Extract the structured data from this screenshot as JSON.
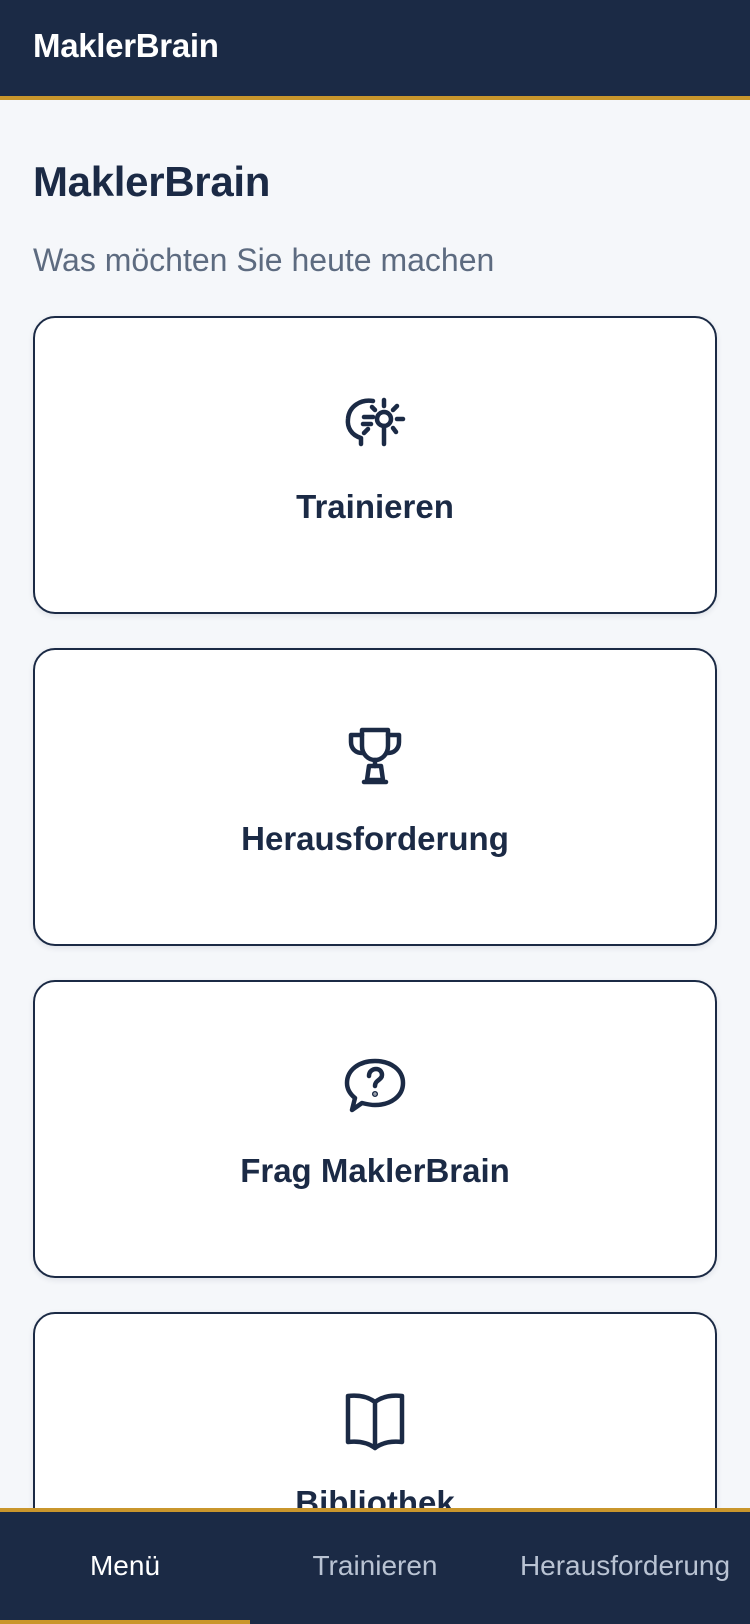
{
  "app": {
    "title": "MaklerBrain"
  },
  "main": {
    "title": "MaklerBrain",
    "subtitle": "Was möchten Sie heute machen",
    "cards": [
      {
        "label": "Trainieren",
        "icon": "brain-lightbulb-icon"
      },
      {
        "label": "Herausforderung",
        "icon": "trophy-icon"
      },
      {
        "label": "Frag MaklerBrain",
        "icon": "question-bubble-icon"
      },
      {
        "label": "Bibliothek",
        "icon": "open-book-icon"
      }
    ]
  },
  "tabbar": {
    "tabs": [
      {
        "label": "Menü",
        "active": true
      },
      {
        "label": "Trainieren",
        "active": false
      },
      {
        "label": "Herausforderung",
        "active": false
      }
    ]
  },
  "colors": {
    "primary": "#1b2a45",
    "accent": "#c9962c",
    "background": "#f5f7fa",
    "muted_text": "#5d6b80"
  }
}
